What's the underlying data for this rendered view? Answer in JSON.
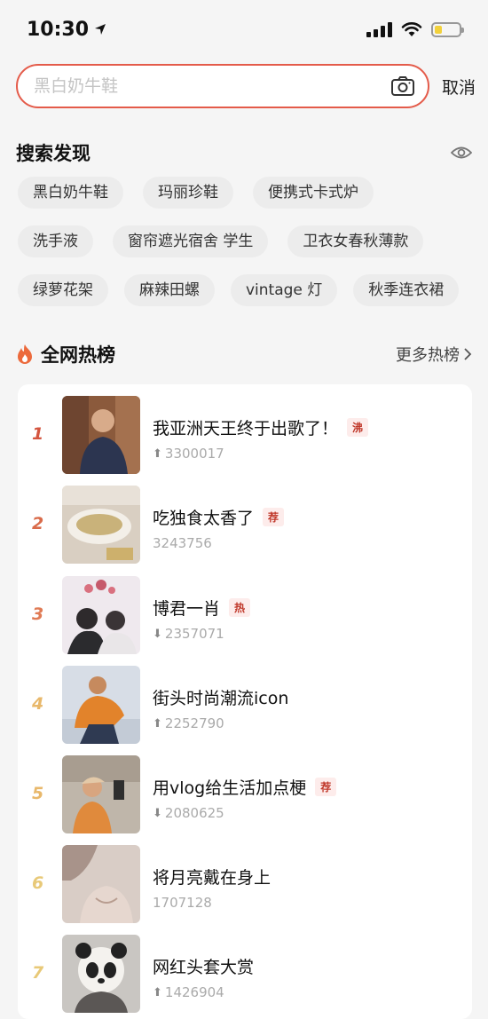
{
  "status_bar": {
    "time": "10:30"
  },
  "search": {
    "placeholder": "黑白奶牛鞋",
    "cancel_label": "取消"
  },
  "discover": {
    "title": "搜索发现",
    "rows": [
      [
        "黑白奶牛鞋",
        "玛丽珍鞋",
        "便携式卡式炉"
      ],
      [
        "洗手液",
        "窗帘遮光宿舍 学生",
        "卫衣女春秋薄款"
      ],
      [
        "绿萝花架",
        "麻辣田螺",
        "vintage 灯",
        "秋季连衣裙"
      ]
    ]
  },
  "hot": {
    "title": "全网热榜",
    "more_label": "更多热榜",
    "items": [
      {
        "rank": "1",
        "title": "我亚洲天王终于出歌了！",
        "badge": "沸",
        "trend": "up",
        "count": "3300017",
        "rank_color": "#d4553f"
      },
      {
        "rank": "2",
        "title": "吃独食太香了",
        "badge": "荐",
        "trend": "none",
        "count": "3243756",
        "rank_color": "#d96b4a"
      },
      {
        "rank": "3",
        "title": "博君一肖",
        "badge": "热",
        "trend": "down",
        "count": "2357071",
        "rank_color": "#e07b55"
      },
      {
        "rank": "4",
        "title": "街头时尚潮流icon",
        "badge": "",
        "trend": "up",
        "count": "2252790",
        "rank_color": "#e8b86b"
      },
      {
        "rank": "5",
        "title": "用vlog给生活加点梗",
        "badge": "荐",
        "trend": "down",
        "count": "2080625",
        "rank_color": "#e8b86b"
      },
      {
        "rank": "6",
        "title": "将月亮戴在身上",
        "badge": "",
        "trend": "none",
        "count": "1707128",
        "rank_color": "#e8c978"
      },
      {
        "rank": "7",
        "title": "网红头套大赏",
        "badge": "",
        "trend": "up",
        "count": "1426904",
        "rank_color": "#e8c978"
      }
    ]
  }
}
